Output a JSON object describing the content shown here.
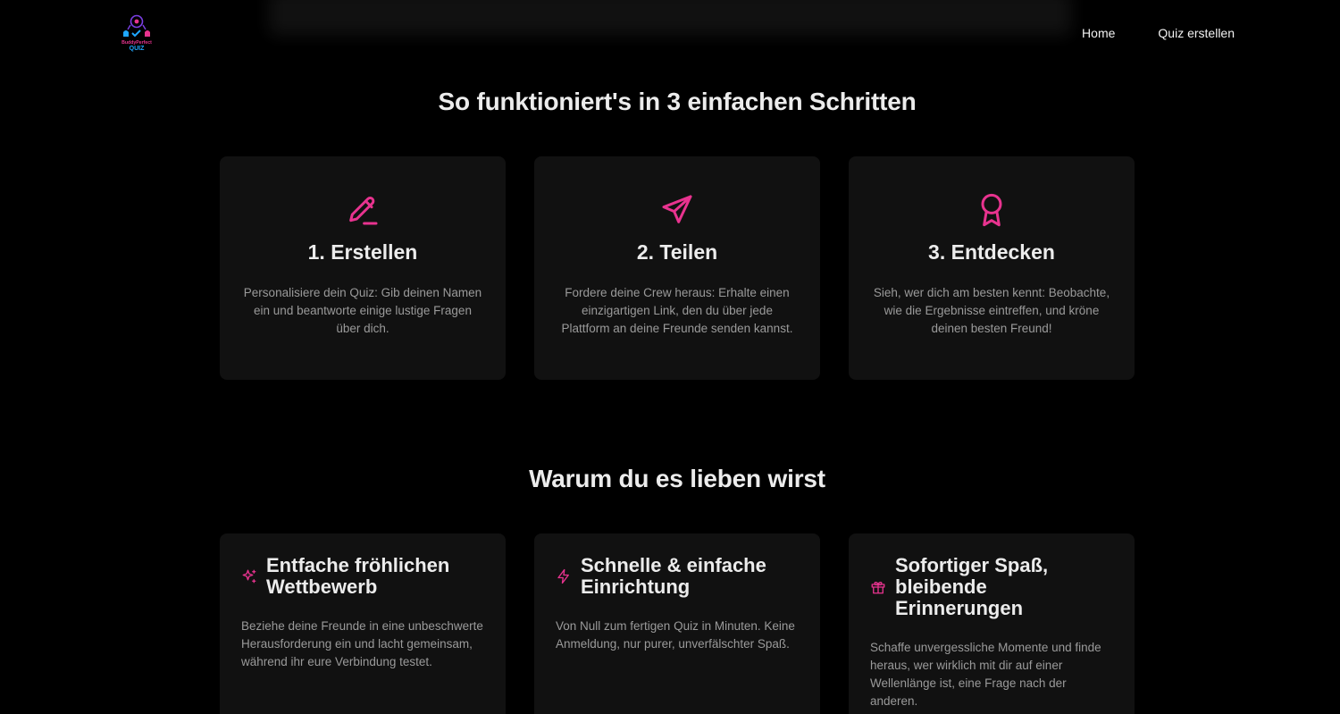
{
  "nav": {
    "logo": {
      "line1": "BuddyPerfect",
      "line2": "QUIZ"
    },
    "links": [
      {
        "label": "Home"
      },
      {
        "label": "Quiz erstellen"
      }
    ]
  },
  "how": {
    "title": "So funktioniert's in 3 einfachen Schritten",
    "steps": [
      {
        "icon": "pencil-icon",
        "title": "1. Erstellen",
        "text": "Personalisiere dein Quiz: Gib deinen Namen ein und beantworte einige lustige Fragen über dich."
      },
      {
        "icon": "send-icon",
        "title": "2. Teilen",
        "text": "Fordere deine Crew heraus: Erhalte einen einzigartigen Link, den du über jede Plattform an deine Freunde senden kannst."
      },
      {
        "icon": "award-icon",
        "title": "3. Entdecken",
        "text": "Sieh, wer dich am besten kennt: Beobachte, wie die Ergebnisse eintreffen, und kröne deinen besten Freund!"
      }
    ]
  },
  "why": {
    "title": "Warum du es lieben wirst",
    "features": [
      {
        "icon": "sparkles-icon",
        "title": "Entfache fröhlichen Wettbewerb",
        "text": "Beziehe deine Freunde in eine unbeschwerte Herausforderung ein und lacht gemeinsam, während ihr eure Verbindung testet."
      },
      {
        "icon": "zap-icon",
        "title": "Schnelle & einfache Einrichtung",
        "text": "Von Null zum fertigen Quiz in Minuten. Keine Anmeldung, nur purer, unverfälschter Spaß."
      },
      {
        "icon": "gift-icon",
        "title": "Sofortiger Spaß, bleibende Erinnerungen",
        "text": "Schaffe unvergessliche Momente und finde heraus, wer wirklich mit dir auf einer Wellenlänge ist, eine Frage nach der anderen."
      }
    ]
  },
  "colors": {
    "accent": "#e8338f",
    "background": "#000000",
    "card": "#111111",
    "muted_text": "#9a9a9a"
  }
}
